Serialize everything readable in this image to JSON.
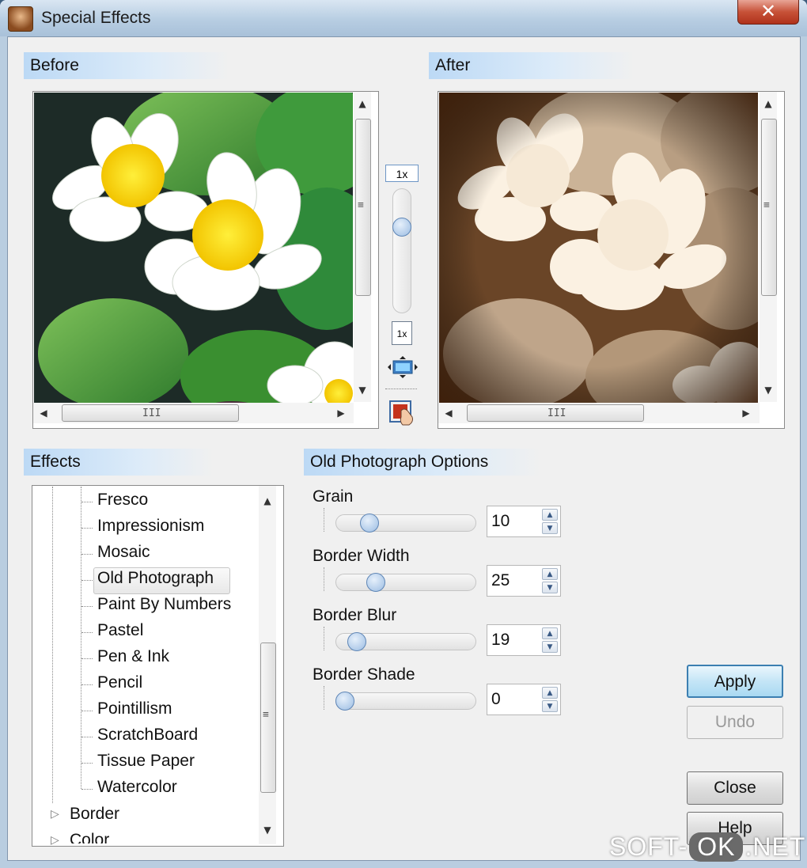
{
  "window": {
    "title": "Special Effects",
    "close_glyph": "✕"
  },
  "before_panel": {
    "title": "Before"
  },
  "after_panel": {
    "title": "After"
  },
  "zoom": {
    "top_label": "1x",
    "bottom_label": "1x"
  },
  "scroll": {
    "grip_v": "≡",
    "grip_h": "III",
    "up": "▲",
    "down": "▼",
    "left": "◀",
    "right": "▶"
  },
  "effects_panel": {
    "title": "Effects",
    "children": [
      "Fresco",
      "Impressionism",
      "Mosaic",
      "Old Photograph",
      "Paint By Numbers",
      "Pastel",
      "Pen & Ink",
      "Pencil",
      "Pointillism",
      "ScratchBoard",
      "Tissue Paper",
      "Watercolor"
    ],
    "selected": "Old Photograph",
    "groups": [
      "Border",
      "Color"
    ],
    "expander_glyph": "▷"
  },
  "options_panel": {
    "title": "Old Photograph Options",
    "options": [
      {
        "label": "Grain",
        "value": "10",
        "level": 0.2
      },
      {
        "label": "Border Width",
        "value": "25",
        "level": 0.25
      },
      {
        "label": "Border Blur",
        "value": "19",
        "level": 0.1
      },
      {
        "label": "Border Shade",
        "value": "0",
        "level": 0.0
      }
    ],
    "spin_up": "▲",
    "spin_down": "▼"
  },
  "buttons": {
    "apply": "Apply",
    "undo": "Undo",
    "close": "Close",
    "help": "Help"
  },
  "watermark": {
    "left": "SOFT-",
    "middle": "OK",
    "right": ".NET"
  }
}
